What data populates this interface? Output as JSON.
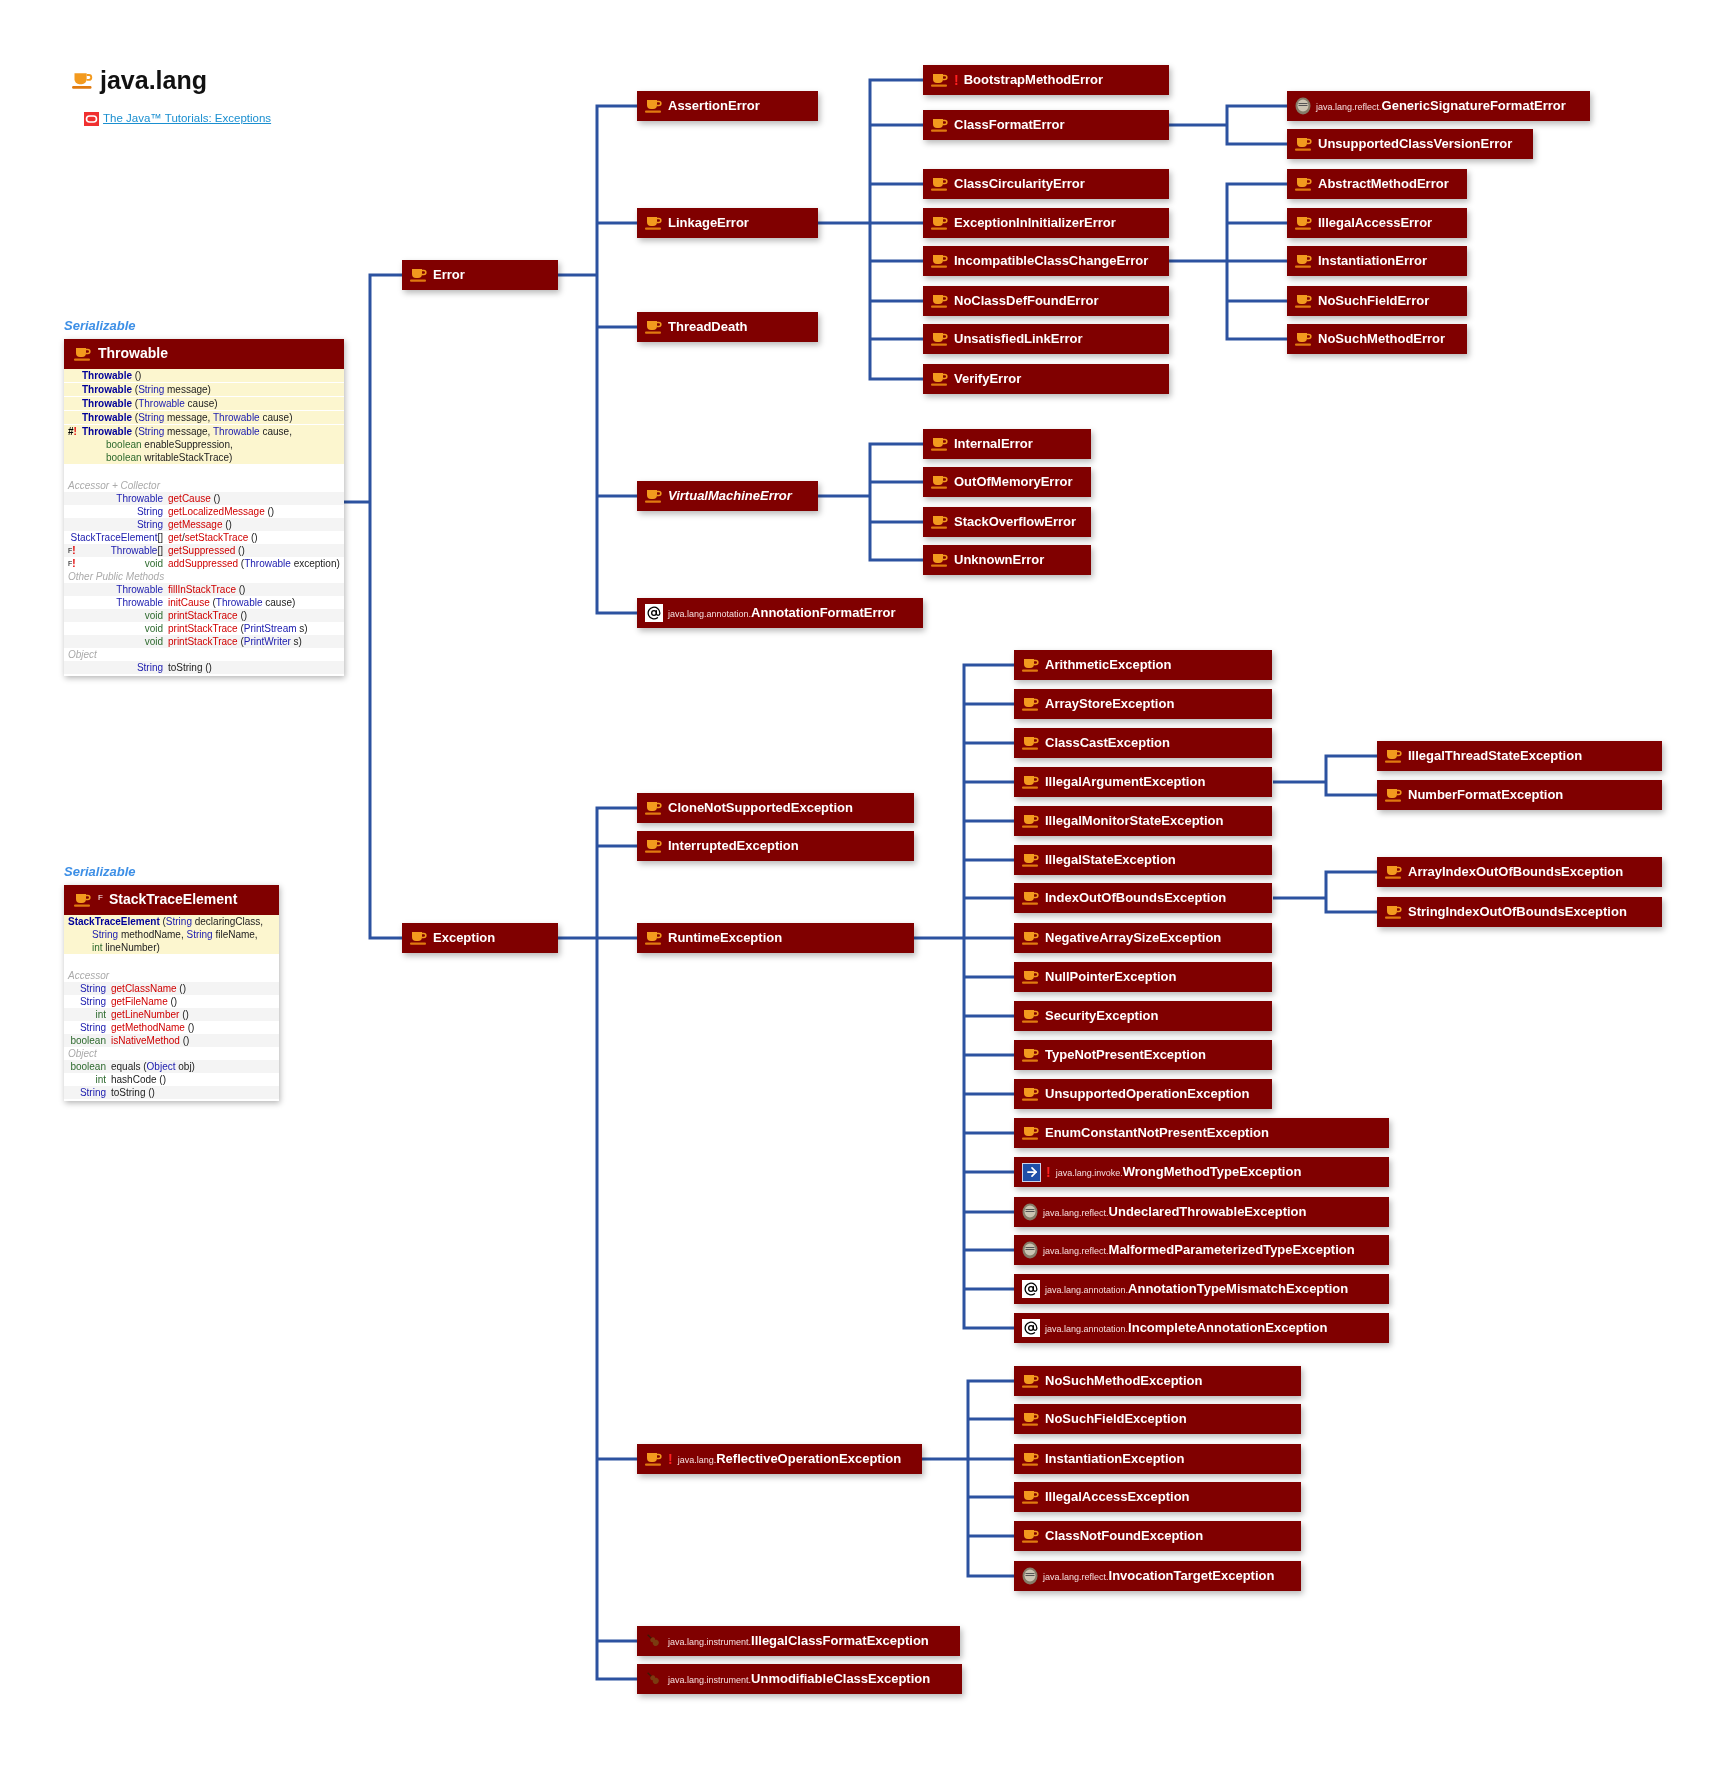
{
  "title": {
    "text": "java.lang"
  },
  "link": {
    "text": "The Java™ Tutorials: Exceptions"
  },
  "cards": [
    {
      "interface": "Serializable",
      "header": {
        "name": "Throwable",
        "kind": "lang"
      },
      "constructors": [
        {
          "lines": [
            [
              {
                "kind": "name",
                "text": "Throwable"
              },
              {
                "kind": "plain",
                "text": " ()"
              }
            ]
          ]
        },
        {
          "lines": [
            [
              {
                "kind": "name",
                "text": "Throwable"
              },
              {
                "kind": "plain",
                "text": " ("
              },
              {
                "kind": "type",
                "text": "String"
              },
              {
                "kind": "plain",
                "text": " message)"
              }
            ]
          ]
        },
        {
          "lines": [
            [
              {
                "kind": "name",
                "text": "Throwable"
              },
              {
                "kind": "plain",
                "text": " ("
              },
              {
                "kind": "type",
                "text": "Throwable"
              },
              {
                "kind": "plain",
                "text": " cause)"
              }
            ]
          ]
        },
        {
          "lines": [
            [
              {
                "kind": "name",
                "text": "Throwable"
              },
              {
                "kind": "plain",
                "text": " ("
              },
              {
                "kind": "type",
                "text": "String"
              },
              {
                "kind": "plain",
                "text": " message, "
              },
              {
                "kind": "type",
                "text": "Throwable"
              },
              {
                "kind": "plain",
                "text": " cause)"
              }
            ]
          ]
        },
        {
          "mark": [
            {
              "kind": "plain",
              "text": "#"
            },
            {
              "kind": "flag",
              "text": "!"
            }
          ],
          "lines": [
            [
              {
                "kind": "name",
                "text": "Throwable"
              },
              {
                "kind": "plain",
                "text": " ("
              },
              {
                "kind": "type",
                "text": "String"
              },
              {
                "kind": "plain",
                "text": " message, "
              },
              {
                "kind": "type",
                "text": "Throwable"
              },
              {
                "kind": "plain",
                "text": " cause,"
              }
            ],
            [
              {
                "kind": "prim",
                "text": "boolean"
              },
              {
                "kind": "plain",
                "text": " enableSuppression,"
              }
            ],
            [
              {
                "kind": "prim",
                "text": "boolean"
              },
              {
                "kind": "plain",
                "text": " writableStackTrace)"
              }
            ]
          ]
        }
      ],
      "sections": [
        {
          "label": "Accessor + Collector",
          "rows": [
            {
              "ret": [
                {
                  "kind": "type",
                  "text": "Throwable"
                }
              ],
              "sig": [
                {
                  "kind": "method",
                  "text": "getCause"
                },
                {
                  "kind": "plain",
                  "text": " ()"
                }
              ]
            },
            {
              "ret": [
                {
                  "kind": "type",
                  "text": "String"
                }
              ],
              "sig": [
                {
                  "kind": "method",
                  "text": "getLocalizedMessage"
                },
                {
                  "kind": "plain",
                  "text": " ()"
                }
              ]
            },
            {
              "ret": [
                {
                  "kind": "type",
                  "text": "String"
                }
              ],
              "sig": [
                {
                  "kind": "method",
                  "text": "getMessage"
                },
                {
                  "kind": "plain",
                  "text": " ()"
                }
              ]
            },
            {
              "ret": [
                {
                  "kind": "type",
                  "text": "StackTraceElement"
                },
                {
                  "kind": "plain",
                  "text": "[]"
                }
              ],
              "sig": [
                {
                  "kind": "method",
                  "text": "get"
                },
                {
                  "kind": "plain",
                  "text": "/"
                },
                {
                  "kind": "method",
                  "text": "setStackTrace"
                },
                {
                  "kind": "plain",
                  "text": " ()"
                }
              ]
            },
            {
              "mark": [
                {
                  "kind": "final",
                  "text": "F"
                },
                {
                  "kind": "flag",
                  "text": "!"
                }
              ],
              "ret": [
                {
                  "kind": "type",
                  "text": "Throwable"
                },
                {
                  "kind": "plain",
                  "text": "[]"
                }
              ],
              "sig": [
                {
                  "kind": "method",
                  "text": "getSuppressed"
                },
                {
                  "kind": "plain",
                  "text": " ()"
                }
              ]
            },
            {
              "mark": [
                {
                  "kind": "final",
                  "text": "F"
                },
                {
                  "kind": "flag",
                  "text": "!"
                }
              ],
              "ret": [
                {
                  "kind": "prim",
                  "text": "void"
                }
              ],
              "sig": [
                {
                  "kind": "method",
                  "text": "addSuppressed"
                },
                {
                  "kind": "plain",
                  "text": " ("
                },
                {
                  "kind": "type",
                  "text": "Throwable"
                },
                {
                  "kind": "plain",
                  "text": " exception)"
                }
              ]
            }
          ]
        },
        {
          "label": "Other Public Methods",
          "rows": [
            {
              "ret": [
                {
                  "kind": "type",
                  "text": "Throwable"
                }
              ],
              "sig": [
                {
                  "kind": "method",
                  "text": "fillInStackTrace"
                },
                {
                  "kind": "plain",
                  "text": " ()"
                }
              ]
            },
            {
              "ret": [
                {
                  "kind": "type",
                  "text": "Throwable"
                }
              ],
              "sig": [
                {
                  "kind": "method",
                  "text": "initCause"
                },
                {
                  "kind": "plain",
                  "text": " ("
                },
                {
                  "kind": "type",
                  "text": "Throwable"
                },
                {
                  "kind": "plain",
                  "text": " cause)"
                }
              ]
            },
            {
              "ret": [
                {
                  "kind": "prim",
                  "text": "void"
                }
              ],
              "sig": [
                {
                  "kind": "method",
                  "text": "printStackTrace"
                },
                {
                  "kind": "plain",
                  "text": " ()"
                }
              ]
            },
            {
              "ret": [
                {
                  "kind": "prim",
                  "text": "void"
                }
              ],
              "sig": [
                {
                  "kind": "method",
                  "text": "printStackTrace"
                },
                {
                  "kind": "plain",
                  "text": " ("
                },
                {
                  "kind": "type",
                  "text": "PrintStream"
                },
                {
                  "kind": "plain",
                  "text": " s)"
                }
              ]
            },
            {
              "ret": [
                {
                  "kind": "prim",
                  "text": "void"
                }
              ],
              "sig": [
                {
                  "kind": "method",
                  "text": "printStackTrace"
                },
                {
                  "kind": "plain",
                  "text": " ("
                },
                {
                  "kind": "type",
                  "text": "PrintWriter"
                },
                {
                  "kind": "plain",
                  "text": " s)"
                }
              ]
            }
          ]
        },
        {
          "label": "Object",
          "rows": [
            {
              "ret": [
                {
                  "kind": "type",
                  "text": "String"
                }
              ],
              "sig": [
                {
                  "kind": "plain",
                  "text": "toString ()"
                }
              ]
            }
          ]
        }
      ]
    },
    {
      "interface": "Serializable",
      "header": {
        "name": "StackTraceElement",
        "kind": "lang",
        "mark": "F"
      },
      "constructors": [
        {
          "lines": [
            [
              {
                "kind": "name",
                "text": "StackTraceElement"
              },
              {
                "kind": "plain",
                "text": " ("
              },
              {
                "kind": "type",
                "text": "String"
              },
              {
                "kind": "plain",
                "text": " declaringClass,"
              }
            ],
            [
              {
                "kind": "type",
                "text": "String"
              },
              {
                "kind": "plain",
                "text": " methodName, "
              },
              {
                "kind": "type",
                "text": "String"
              },
              {
                "kind": "plain",
                "text": " fileName,"
              }
            ],
            [
              {
                "kind": "prim",
                "text": "int"
              },
              {
                "kind": "plain",
                "text": " lineNumber)"
              }
            ]
          ]
        }
      ],
      "sections": [
        {
          "label": "Accessor",
          "rows": [
            {
              "ret": [
                {
                  "kind": "type",
                  "text": "String"
                }
              ],
              "sig": [
                {
                  "kind": "method",
                  "text": "getClassName"
                },
                {
                  "kind": "plain",
                  "text": " ()"
                }
              ]
            },
            {
              "ret": [
                {
                  "kind": "type",
                  "text": "String"
                }
              ],
              "sig": [
                {
                  "kind": "method",
                  "text": "getFileName"
                },
                {
                  "kind": "plain",
                  "text": " ()"
                }
              ]
            },
            {
              "ret": [
                {
                  "kind": "prim",
                  "text": "int"
                }
              ],
              "sig": [
                {
                  "kind": "method",
                  "text": "getLineNumber"
                },
                {
                  "kind": "plain",
                  "text": " ()"
                }
              ]
            },
            {
              "ret": [
                {
                  "kind": "type",
                  "text": "String"
                }
              ],
              "sig": [
                {
                  "kind": "method",
                  "text": "getMethodName"
                },
                {
                  "kind": "plain",
                  "text": " ()"
                }
              ]
            },
            {
              "ret": [
                {
                  "kind": "prim",
                  "text": "boolean"
                }
              ],
              "sig": [
                {
                  "kind": "method",
                  "text": "isNativeMethod"
                },
                {
                  "kind": "plain",
                  "text": " ()"
                }
              ]
            }
          ]
        },
        {
          "label": "Object",
          "rows": [
            {
              "ret": [
                {
                  "kind": "prim",
                  "text": "boolean"
                }
              ],
              "sig": [
                {
                  "kind": "plain",
                  "text": "equals ("
                },
                {
                  "kind": "type",
                  "text": "Object"
                },
                {
                  "kind": "plain",
                  "text": " obj)"
                }
              ]
            },
            {
              "ret": [
                {
                  "kind": "prim",
                  "text": "int"
                }
              ],
              "sig": [
                {
                  "kind": "plain",
                  "text": "hashCode ()"
                }
              ]
            },
            {
              "ret": [
                {
                  "kind": "type",
                  "text": "String"
                }
              ],
              "sig": [
                {
                  "kind": "plain",
                  "text": "toString ()"
                }
              ]
            }
          ]
        }
      ]
    }
  ],
  "hierarchy": [
    {
      "name": "Error",
      "kind": "lang",
      "children": [
        {
          "name": "AssertionError",
          "kind": "lang"
        },
        {
          "name": "LinkageError",
          "kind": "lang",
          "children": [
            {
              "name": "BootstrapMethodError",
              "kind": "lang",
              "flag": "!"
            },
            {
              "name": "ClassFormatError",
              "kind": "lang",
              "children": [
                {
                  "name": "GenericSignatureFormatError",
                  "kind": "reflect",
                  "package": "java.lang.reflect."
                },
                {
                  "name": "UnsupportedClassVersionError",
                  "kind": "lang"
                }
              ]
            },
            {
              "name": "ClassCircularityError",
              "kind": "lang"
            },
            {
              "name": "ExceptionInInitializerError",
              "kind": "lang"
            },
            {
              "name": "IncompatibleClassChangeError",
              "kind": "lang",
              "children": [
                {
                  "name": "AbstractMethodError",
                  "kind": "lang"
                },
                {
                  "name": "IllegalAccessError",
                  "kind": "lang"
                },
                {
                  "name": "InstantiationError",
                  "kind": "lang"
                },
                {
                  "name": "NoSuchFieldError",
                  "kind": "lang"
                },
                {
                  "name": "NoSuchMethodError",
                  "kind": "lang"
                }
              ]
            },
            {
              "name": "NoClassDefFoundError",
              "kind": "lang"
            },
            {
              "name": "UnsatisfiedLinkError",
              "kind": "lang"
            },
            {
              "name": "VerifyError",
              "kind": "lang"
            }
          ]
        },
        {
          "name": "ThreadDeath",
          "kind": "lang"
        },
        {
          "name": "VirtualMachineError",
          "kind": "lang",
          "abstract": true,
          "children": [
            {
              "name": "InternalError",
              "kind": "lang"
            },
            {
              "name": "OutOfMemoryError",
              "kind": "lang"
            },
            {
              "name": "StackOverflowError",
              "kind": "lang"
            },
            {
              "name": "UnknownError",
              "kind": "lang"
            }
          ]
        },
        {
          "name": "AnnotationFormatError",
          "kind": "annotation",
          "package": "java.lang.annotation."
        }
      ]
    },
    {
      "name": "Exception",
      "kind": "lang",
      "children": [
        {
          "name": "CloneNotSupportedException",
          "kind": "lang"
        },
        {
          "name": "InterruptedException",
          "kind": "lang"
        },
        {
          "name": "RuntimeException",
          "kind": "lang",
          "children": [
            {
              "name": "ArithmeticException",
              "kind": "lang"
            },
            {
              "name": "ArrayStoreException",
              "kind": "lang"
            },
            {
              "name": "ClassCastException",
              "kind": "lang"
            },
            {
              "name": "IllegalArgumentException",
              "kind": "lang",
              "children": [
                {
                  "name": "IllegalThreadStateException",
                  "kind": "lang"
                },
                {
                  "name": "NumberFormatException",
                  "kind": "lang"
                }
              ]
            },
            {
              "name": "IllegalMonitorStateException",
              "kind": "lang"
            },
            {
              "name": "IllegalStateException",
              "kind": "lang"
            },
            {
              "name": "IndexOutOfBoundsException",
              "kind": "lang",
              "children": [
                {
                  "name": "ArrayIndexOutOfBoundsException",
                  "kind": "lang"
                },
                {
                  "name": "StringIndexOutOfBoundsException",
                  "kind": "lang"
                }
              ]
            },
            {
              "name": "NegativeArraySizeException",
              "kind": "lang"
            },
            {
              "name": "NullPointerException",
              "kind": "lang"
            },
            {
              "name": "SecurityException",
              "kind": "lang"
            },
            {
              "name": "TypeNotPresentException",
              "kind": "lang"
            },
            {
              "name": "UnsupportedOperationException",
              "kind": "lang"
            },
            {
              "name": "EnumConstantNotPresentException",
              "kind": "lang"
            },
            {
              "name": "WrongMethodTypeException",
              "kind": "invoke",
              "package": "java.lang.invoke.",
              "flag": "!"
            },
            {
              "name": "UndeclaredThrowableException",
              "kind": "reflect",
              "package": "java.lang.reflect."
            },
            {
              "name": "MalformedParameterizedTypeException",
              "kind": "reflect",
              "package": "java.lang.reflect."
            },
            {
              "name": "AnnotationTypeMismatchException",
              "kind": "annotation",
              "package": "java.lang.annotation."
            },
            {
              "name": "IncompleteAnnotationException",
              "kind": "annotation",
              "package": "java.lang.annotation."
            }
          ]
        },
        {
          "name": "ReflectiveOperationException",
          "kind": "lang",
          "package": "java.lang.",
          "flag": "!",
          "children": [
            {
              "name": "NoSuchMethodException",
              "kind": "lang"
            },
            {
              "name": "NoSuchFieldException",
              "kind": "lang"
            },
            {
              "name": "InstantiationException",
              "kind": "lang"
            },
            {
              "name": "IllegalAccessException",
              "kind": "lang"
            },
            {
              "name": "ClassNotFoundException",
              "kind": "lang"
            },
            {
              "name": "InvocationTargetException",
              "kind": "reflect",
              "package": "java.lang.reflect."
            }
          ]
        },
        {
          "name": "IllegalClassFormatException",
          "kind": "instrument",
          "package": "java.lang.instrument."
        },
        {
          "name": "UnmodifiableClassException",
          "kind": "instrument",
          "package": "java.lang.instrument."
        }
      ]
    }
  ]
}
